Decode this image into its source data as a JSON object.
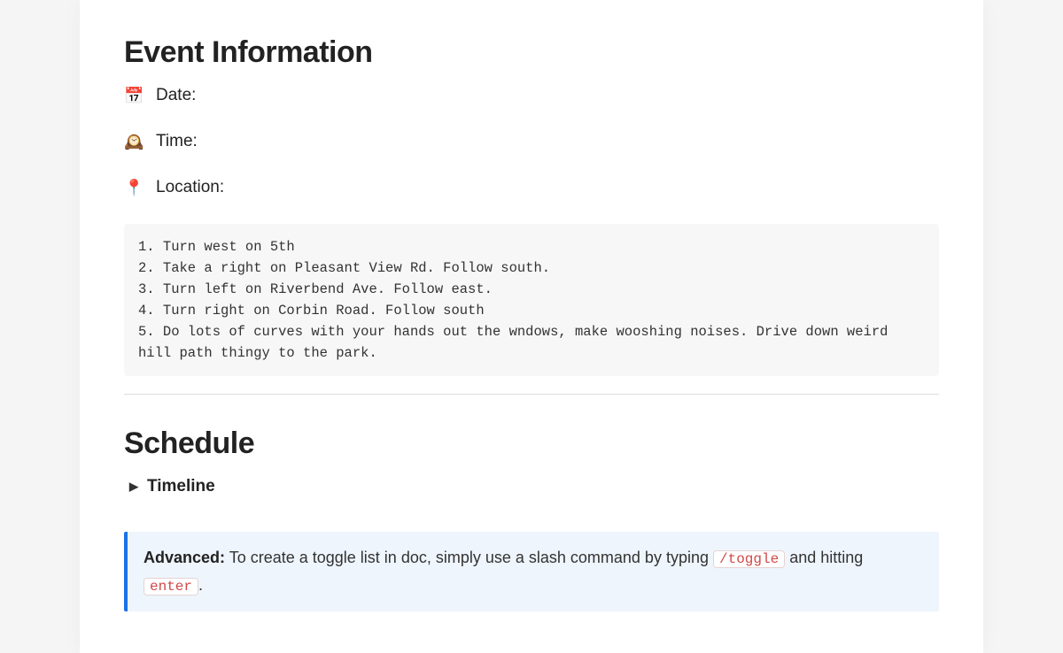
{
  "event": {
    "heading": "Event Information",
    "date_icon": "📅",
    "date_label": "Date:",
    "time_icon": "🕰️",
    "time_label": "Time:",
    "location_icon": "📍",
    "location_label": "Location:",
    "directions": "1. Turn west on 5th\n2. Take a right on Pleasant View Rd. Follow south.\n3. Turn left on Riverbend Ave. Follow east.\n4. Turn right on Corbin Road. Follow south\n5. Do lots of curves with your hands out the wndows, make wooshing noises. Drive down weird hill path thingy to the park."
  },
  "schedule": {
    "heading": "Schedule",
    "toggle_label": "Timeline"
  },
  "callout": {
    "prefix": "Advanced:",
    "text_before_code1": " To create a toggle list in doc, simply use a slash command by typing ",
    "code1": "/toggle",
    "text_between": " and hitting ",
    "code2": "enter",
    "text_after": "."
  }
}
